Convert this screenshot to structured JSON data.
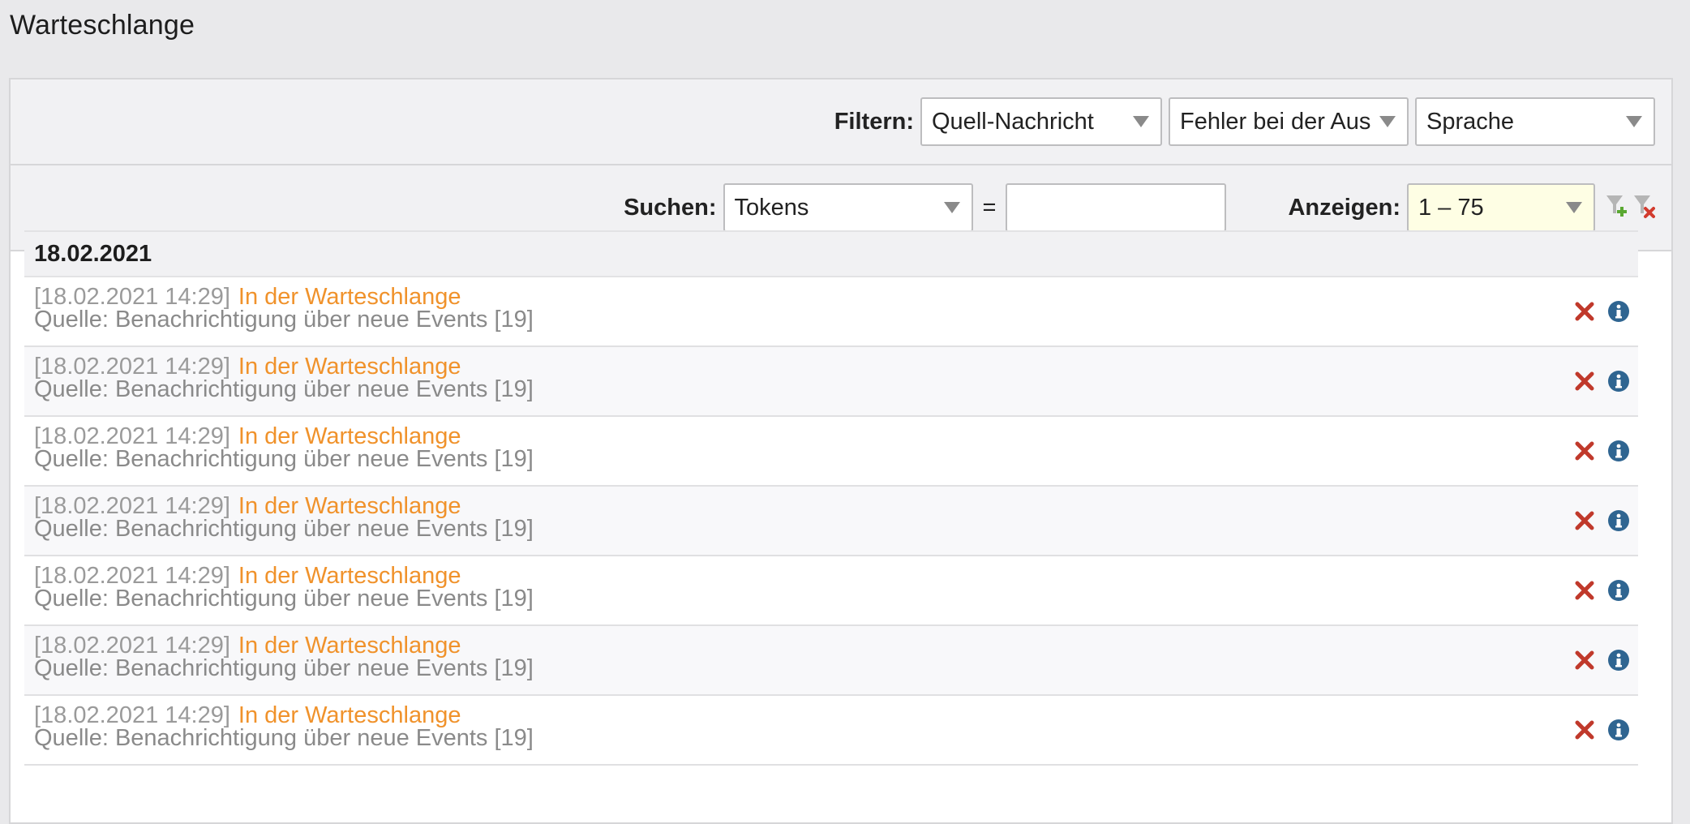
{
  "page": {
    "title": "Warteschlange"
  },
  "filter_bar": {
    "label": "Filtern:",
    "selects": [
      {
        "value": "Quell-Nachricht"
      },
      {
        "value": "Fehler bei der Ausl"
      },
      {
        "value": "Sprache"
      }
    ]
  },
  "search_bar": {
    "label": "Suchen:",
    "field_select": "Tokens",
    "equals": "=",
    "search_value": "",
    "show_label": "Anzeigen:",
    "show_select": "1 – 75"
  },
  "groups": [
    {
      "date": "18.02.2021",
      "entries": [
        {
          "timestamp": "[18.02.2021 14:29]",
          "status": "In der Warteschlange",
          "source": "Quelle: Benachrichtigung über neue Events [19]"
        },
        {
          "timestamp": "[18.02.2021 14:29]",
          "status": "In der Warteschlange",
          "source": "Quelle: Benachrichtigung über neue Events [19]"
        },
        {
          "timestamp": "[18.02.2021 14:29]",
          "status": "In der Warteschlange",
          "source": "Quelle: Benachrichtigung über neue Events [19]"
        },
        {
          "timestamp": "[18.02.2021 14:29]",
          "status": "In der Warteschlange",
          "source": "Quelle: Benachrichtigung über neue Events [19]"
        },
        {
          "timestamp": "[18.02.2021 14:29]",
          "status": "In der Warteschlange",
          "source": "Quelle: Benachrichtigung über neue Events [19]"
        },
        {
          "timestamp": "[18.02.2021 14:29]",
          "status": "In der Warteschlange",
          "source": "Quelle: Benachrichtigung über neue Events [19]"
        },
        {
          "timestamp": "[18.02.2021 14:29]",
          "status": "In der Warteschlange",
          "source": "Quelle: Benachrichtigung über neue Events [19]"
        }
      ]
    }
  ],
  "icons": {
    "delete": "close-icon",
    "info": "info-icon",
    "add_filter": "filter-add-icon",
    "remove_filter": "filter-remove-icon"
  },
  "colors": {
    "status_queued": "#f0922b",
    "delete": "#c0392b",
    "info": "#2f6591"
  }
}
